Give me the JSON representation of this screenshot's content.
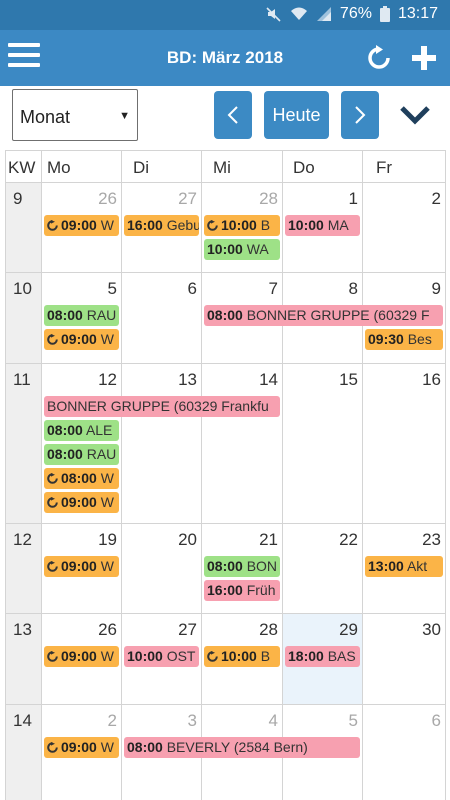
{
  "status": {
    "battery": "76%",
    "time": "13:17"
  },
  "appbar": {
    "title": "BD: März 2018"
  },
  "toolbar": {
    "view_select": "Monat",
    "prev": "<",
    "today": "Heute",
    "next": ">"
  },
  "headers": [
    "KW",
    "Mo",
    "Di",
    "Mi",
    "Do",
    "Fr"
  ],
  "weeks": [
    {
      "kw": "9",
      "days": [
        {
          "n": "26",
          "muted": true
        },
        {
          "n": "27",
          "muted": true
        },
        {
          "n": "28",
          "muted": true
        },
        {
          "n": "1"
        },
        {
          "n": "2"
        }
      ],
      "events": [
        {
          "col": 0,
          "row": 0,
          "span": 1,
          "color": "orange",
          "rep": true,
          "time": "09:00",
          "text": "W"
        },
        {
          "col": 1,
          "row": 0,
          "span": 1,
          "color": "orange",
          "rep": false,
          "time": "16:00",
          "text": "Geburtstag"
        },
        {
          "col": 2,
          "row": 0,
          "span": 1,
          "color": "orange",
          "rep": true,
          "time": "10:00",
          "text": "B"
        },
        {
          "col": 2,
          "row": 1,
          "span": 1,
          "color": "green",
          "rep": false,
          "time": "10:00",
          "text": "WA"
        },
        {
          "col": 3,
          "row": 0,
          "span": 1,
          "color": "pink",
          "rep": false,
          "time": "10:00",
          "text": "MA"
        }
      ]
    },
    {
      "kw": "10",
      "days": [
        {
          "n": "5"
        },
        {
          "n": "6"
        },
        {
          "n": "7"
        },
        {
          "n": "8"
        },
        {
          "n": "9"
        }
      ],
      "events": [
        {
          "col": 0,
          "row": 0,
          "span": 1,
          "color": "green",
          "rep": false,
          "time": "08:00",
          "text": "RAU"
        },
        {
          "col": 0,
          "row": 1,
          "span": 1,
          "color": "orange",
          "rep": true,
          "time": "09:00",
          "text": "W"
        },
        {
          "col": 2,
          "row": 0,
          "span": 3,
          "color": "pink",
          "rep": false,
          "time": "08:00",
          "text": "BONNER GRUPPE (60329 F"
        },
        {
          "col": 4,
          "row": 1,
          "span": 1,
          "color": "orange",
          "rep": false,
          "time": "09:30",
          "text": "Bes"
        }
      ]
    },
    {
      "kw": "11",
      "days": [
        {
          "n": "12"
        },
        {
          "n": "13"
        },
        {
          "n": "14"
        },
        {
          "n": "15"
        },
        {
          "n": "16"
        }
      ],
      "events": [
        {
          "col": 0,
          "row": 0,
          "span": 3,
          "color": "pink",
          "rep": false,
          "time": "",
          "text": "BONNER GRUPPE (60329 Frankfu"
        },
        {
          "col": 0,
          "row": 1,
          "span": 1,
          "color": "green",
          "rep": false,
          "time": "08:00",
          "text": "ALE"
        },
        {
          "col": 0,
          "row": 2,
          "span": 1,
          "color": "green",
          "rep": false,
          "time": "08:00",
          "text": "RAU"
        },
        {
          "col": 0,
          "row": 3,
          "span": 1,
          "color": "orange",
          "rep": true,
          "time": "08:00",
          "text": "W"
        },
        {
          "col": 0,
          "row": 4,
          "span": 1,
          "color": "orange",
          "rep": true,
          "time": "09:00",
          "text": "W"
        }
      ]
    },
    {
      "kw": "12",
      "days": [
        {
          "n": "19"
        },
        {
          "n": "20"
        },
        {
          "n": "21"
        },
        {
          "n": "22"
        },
        {
          "n": "23"
        }
      ],
      "events": [
        {
          "col": 0,
          "row": 0,
          "span": 1,
          "color": "orange",
          "rep": true,
          "time": "09:00",
          "text": "W"
        },
        {
          "col": 2,
          "row": 0,
          "span": 1,
          "color": "green",
          "rep": false,
          "time": "08:00",
          "text": "BON"
        },
        {
          "col": 2,
          "row": 1,
          "span": 1,
          "color": "pink",
          "rep": false,
          "time": "16:00",
          "text": "Früh"
        },
        {
          "col": 4,
          "row": 0,
          "span": 1,
          "color": "orange",
          "rep": false,
          "time": "13:00",
          "text": "Akt"
        }
      ]
    },
    {
      "kw": "13",
      "days": [
        {
          "n": "26"
        },
        {
          "n": "27"
        },
        {
          "n": "28"
        },
        {
          "n": "29",
          "today": true
        },
        {
          "n": "30"
        }
      ],
      "events": [
        {
          "col": 0,
          "row": 0,
          "span": 1,
          "color": "orange",
          "rep": true,
          "time": "09:00",
          "text": "W"
        },
        {
          "col": 1,
          "row": 0,
          "span": 1,
          "color": "pink",
          "rep": false,
          "time": "10:00",
          "text": "OST"
        },
        {
          "col": 2,
          "row": 0,
          "span": 1,
          "color": "orange",
          "rep": true,
          "time": "10:00",
          "text": "B"
        },
        {
          "col": 3,
          "row": 0,
          "span": 1,
          "color": "pink",
          "rep": false,
          "time": "18:00",
          "text": "BAS"
        }
      ]
    },
    {
      "kw": "14",
      "days": [
        {
          "n": "2",
          "muted": true
        },
        {
          "n": "3",
          "muted": true
        },
        {
          "n": "4",
          "muted": true
        },
        {
          "n": "5",
          "muted": true
        },
        {
          "n": "6",
          "muted": true
        }
      ],
      "events": [
        {
          "col": 0,
          "row": 0,
          "span": 1,
          "color": "orange",
          "rep": true,
          "time": "09:00",
          "text": "W"
        },
        {
          "col": 1,
          "row": 0,
          "span": 3,
          "color": "pink",
          "rep": false,
          "time": "08:00",
          "text": "BEVERLY (2584 Bern)"
        }
      ]
    }
  ]
}
